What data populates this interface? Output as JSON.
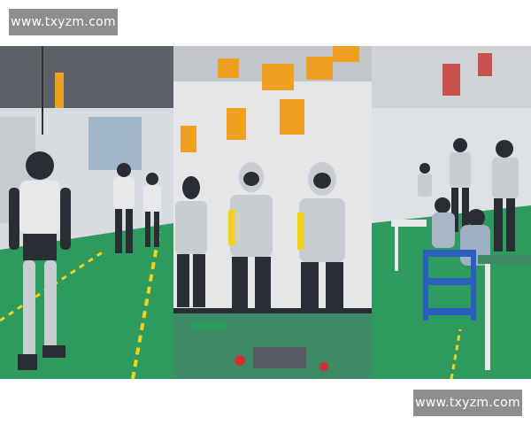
{
  "watermark_top": "www.txyzm.com",
  "watermark_bottom": "www.txyzm.com",
  "colors": {
    "floor_green": "#2f9a5e",
    "ceiling_gray": "#5b6167",
    "hoist_orange": "#f0a020",
    "robot_silver": "#c9ccd0",
    "robot_dark": "#2a2d33",
    "hazard_yellow": "#f2d21a"
  }
}
